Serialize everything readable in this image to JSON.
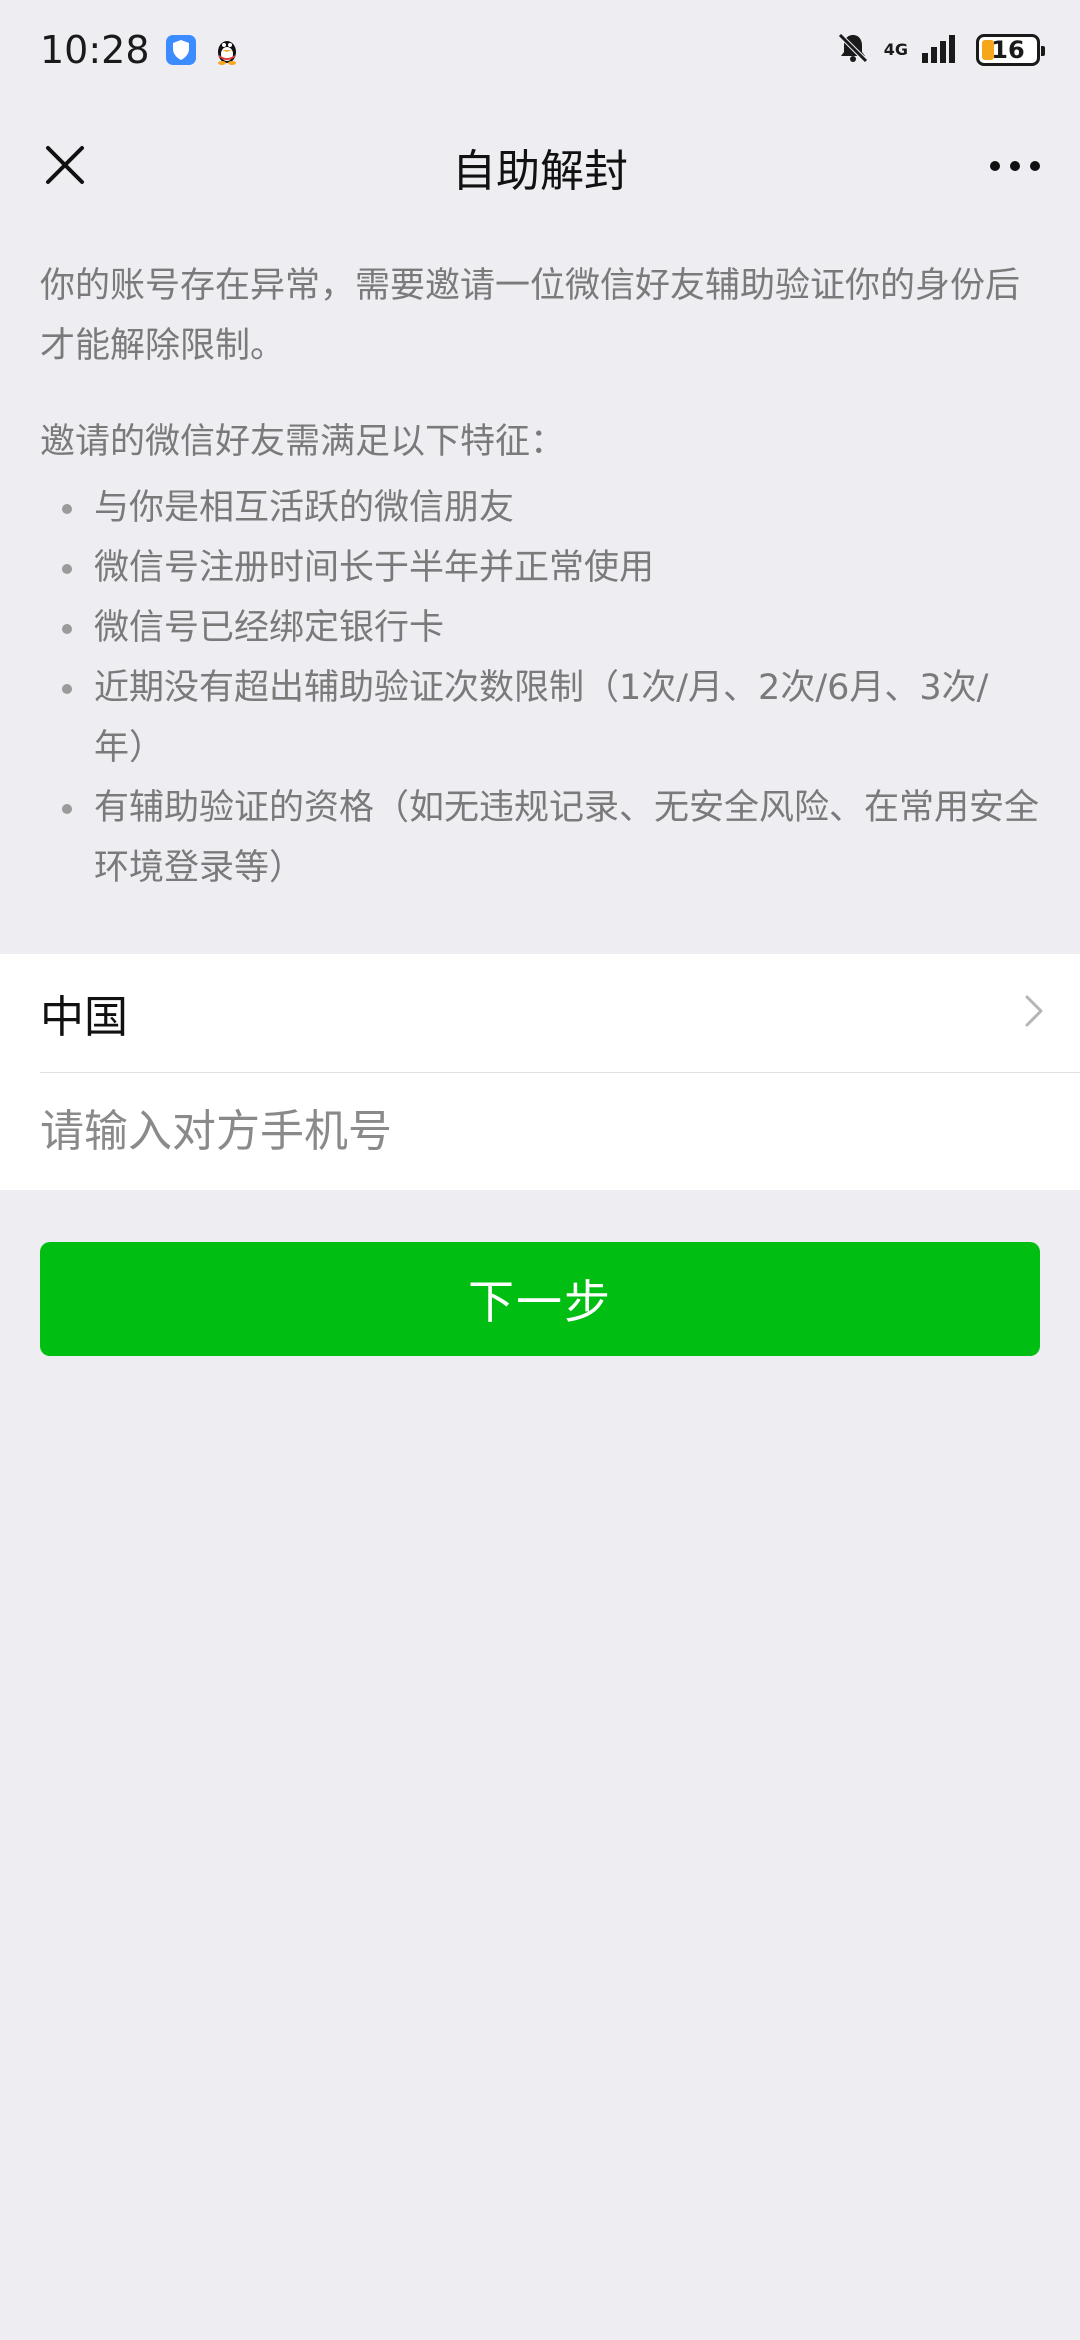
{
  "status_bar": {
    "time": "10:28",
    "network": "4G",
    "battery": "16",
    "icons": [
      "shield-app-icon",
      "qq-penguin-icon",
      "bell-muted-icon",
      "signal-icon",
      "battery-icon"
    ]
  },
  "nav": {
    "title": "自助解封",
    "close_icon": "close-icon",
    "more_icon": "more-icon"
  },
  "content": {
    "description": "你的账号存在异常，需要邀请一位微信好友辅助验证你的身份后才能解除限制。",
    "requirements_title": "邀请的微信好友需满足以下特征：",
    "requirements": [
      "与你是相互活跃的微信朋友",
      "微信号注册时间长于半年并正常使用",
      "微信号已经绑定银行卡",
      "近期没有超出辅助验证次数限制（1次/月、2次/6月、3次/年）",
      "有辅助验证的资格（如无违规记录、无安全风险、在常用安全环境登录等）"
    ]
  },
  "form": {
    "country": "中国",
    "phone_placeholder": "请输入对方手机号",
    "phone_value": ""
  },
  "next_button": "下一步",
  "colors": {
    "background": "#EDEDF2",
    "primary_green": "#00BE12",
    "text_secondary": "#7a7a7a",
    "battery_low": "#f6a61a"
  }
}
